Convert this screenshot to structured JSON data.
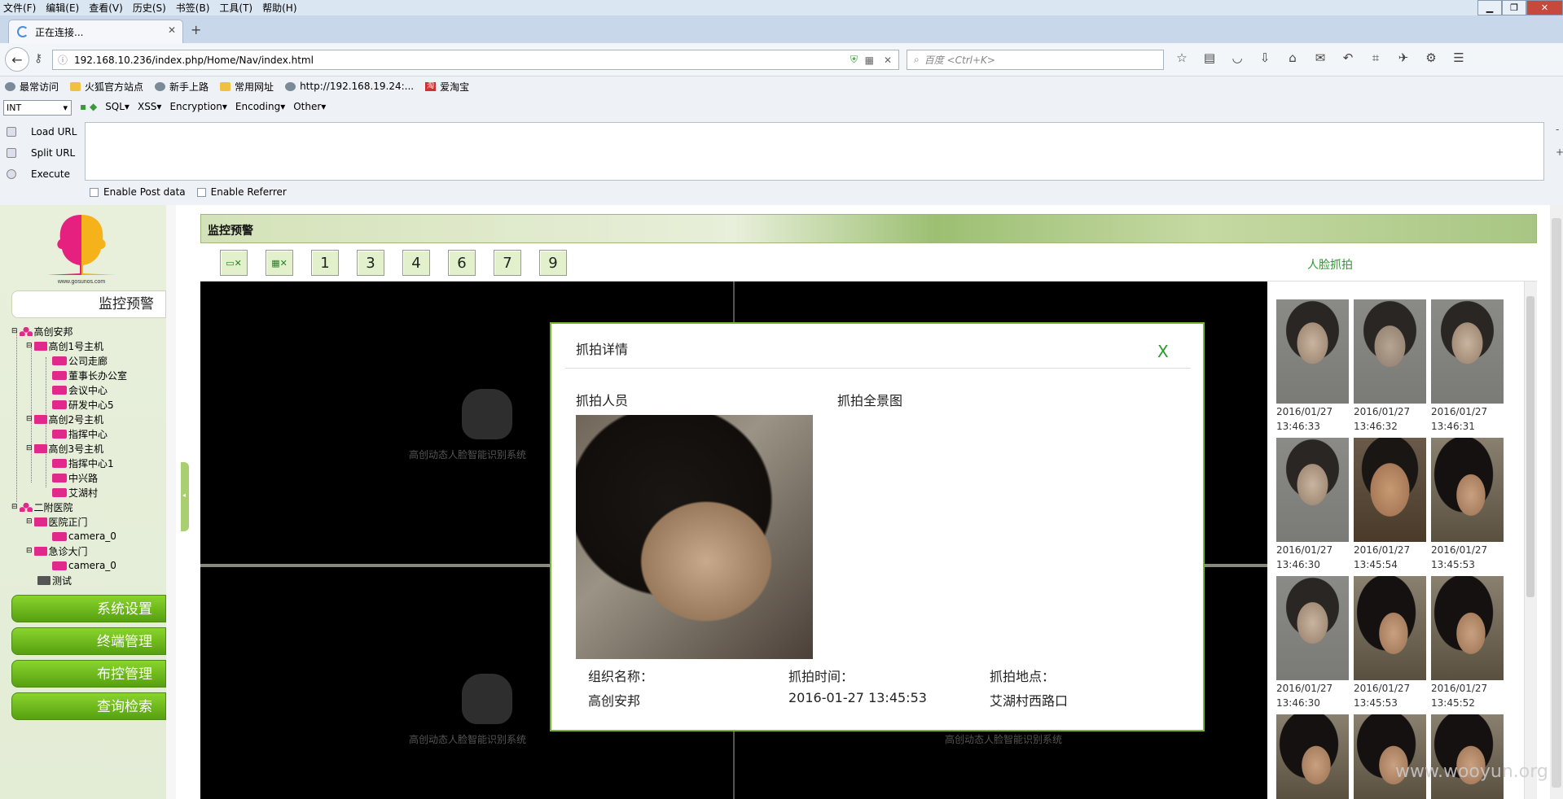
{
  "browser": {
    "menu": [
      "文件(F)",
      "编辑(E)",
      "查看(V)",
      "历史(S)",
      "书签(B)",
      "工具(T)",
      "帮助(H)"
    ],
    "tab_title": "正在连接...",
    "url": "192.168.10.236/index.php/Home/Nav/index.html",
    "search_placeholder": "百度 <Ctrl+K>",
    "bookmarks": [
      "最常访问",
      "火狐官方站点",
      "新手上路",
      "常用网址",
      "http://192.168.19.24:...",
      "爱淘宝"
    ]
  },
  "hackbar": {
    "select_value": "INT",
    "menus": [
      "SQL▾",
      "XSS▾",
      "Encryption▾",
      "Encoding▾",
      "Other▾"
    ],
    "buttons": [
      "Load URL",
      "Split URL",
      "Execute"
    ],
    "checkboxes": [
      "Enable Post data",
      "Enable Referrer"
    ]
  },
  "sidebar": {
    "logo_caption": "www.gosunos.com",
    "title": "监控预警",
    "tree": [
      {
        "label": "高创安邦",
        "type": "org"
      },
      {
        "label": "高创1号主机",
        "type": "host"
      },
      {
        "label": "公司走廊",
        "type": "cam"
      },
      {
        "label": "董事长办公室",
        "type": "cam"
      },
      {
        "label": "会议中心",
        "type": "cam"
      },
      {
        "label": "研发中心5",
        "type": "cam"
      },
      {
        "label": "高创2号主机",
        "type": "host"
      },
      {
        "label": "指挥中心",
        "type": "cam"
      },
      {
        "label": "高创3号主机",
        "type": "host"
      },
      {
        "label": "指挥中心1",
        "type": "cam"
      },
      {
        "label": "中兴路",
        "type": "cam"
      },
      {
        "label": "艾湖村",
        "type": "cam"
      },
      {
        "label": "二附医院",
        "type": "org"
      },
      {
        "label": "医院正门",
        "type": "host"
      },
      {
        "label": "camera_0",
        "type": "cam"
      },
      {
        "label": "急诊大门",
        "type": "host"
      },
      {
        "label": "camera_0",
        "type": "cam"
      },
      {
        "label": "测试",
        "type": "test"
      }
    ],
    "buttons": [
      "系统设置",
      "终端管理",
      "布控管理",
      "查询检索"
    ]
  },
  "panel": {
    "title": "监控预警",
    "layout_buttons": [
      "",
      "",
      "1",
      "3",
      "4",
      "6",
      "7",
      "9"
    ],
    "face_capture_label": "人脸抓拍",
    "video_watermark": "高创动态人脸智能识别系统"
  },
  "thumbs": [
    {
      "date": "2016/01/27",
      "time": "13:46:33"
    },
    {
      "date": "2016/01/27",
      "time": "13:46:32"
    },
    {
      "date": "2016/01/27",
      "time": "13:46:31"
    },
    {
      "date": "2016/01/27",
      "time": "13:46:30"
    },
    {
      "date": "2016/01/27",
      "time": "13:45:54"
    },
    {
      "date": "2016/01/27",
      "time": "13:45:53"
    },
    {
      "date": "2016/01/27",
      "time": "13:46:30"
    },
    {
      "date": "2016/01/27",
      "time": "13:45:53"
    },
    {
      "date": "2016/01/27",
      "time": "13:45:52"
    }
  ],
  "modal": {
    "title": "抓拍详情",
    "close": "X",
    "person_label": "抓拍人员",
    "scene_label": "抓拍全景图",
    "org_label": "组织名称：",
    "org_value": "高创安邦",
    "time_label": "抓拍时间：",
    "time_value": "2016-01-27 13:45:53",
    "place_label": "抓拍地点：",
    "place_value": "艾湖村西路口"
  },
  "watermark": "www.wooyun.org"
}
